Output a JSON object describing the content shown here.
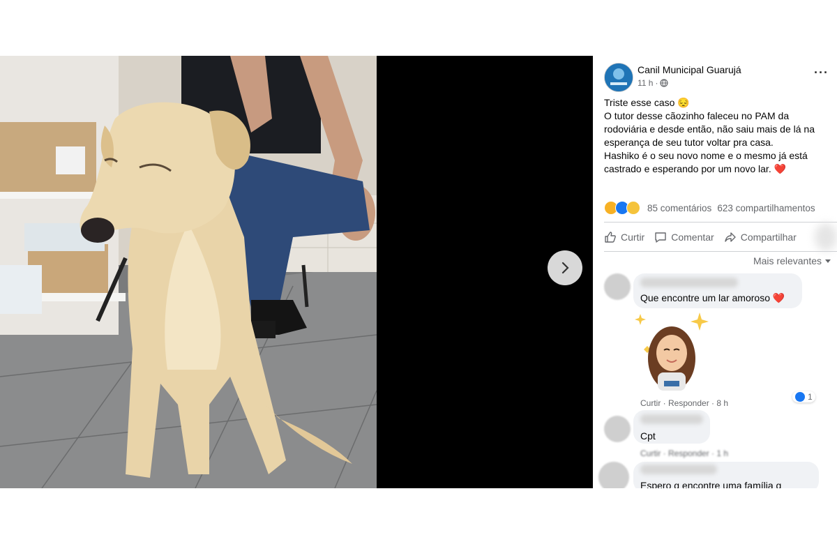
{
  "post": {
    "page_name": "Canil Municipal Guarujá",
    "time": "11 h",
    "time_separator": "·",
    "text_lines": [
      "Triste esse caso 😔",
      "O tutor desse cãozinho faleceu no PAM da rodoviária e desde então, não saiu mais de lá na esperança de seu tutor voltar pra casa.",
      "Hashiko é o seu novo nome e o mesmo já está castrado e esperando por um novo lar. ❤️"
    ],
    "comments_count": "85 comentários",
    "shares_count": "623 compartilhamentos",
    "like_label": "Curtir",
    "comment_label": "Comentar",
    "share_label": "Compartilhar",
    "sort_label": "Mais relevantes",
    "more_label": "···"
  },
  "comments": [
    {
      "text": "Que encontre um lar amoroso ❤️",
      "meta": "Curtir · Responder · 8 h",
      "likes": "1"
    },
    {
      "text": "Cpt",
      "meta": "Curtir · Responder · 1 h"
    },
    {
      "text": "Espero q encontre uma família q"
    }
  ],
  "colors": {
    "accent": "#1877f2",
    "page_avatar": "#1f74b6",
    "bubble": "#f0f2f5",
    "muted_text": "#65676b",
    "viewer_bg": "#000000"
  },
  "icons": [
    "globe-icon",
    "more-icon",
    "like-icon",
    "comment-icon",
    "share-icon",
    "chevron-down-icon",
    "chevron-right-icon"
  ]
}
